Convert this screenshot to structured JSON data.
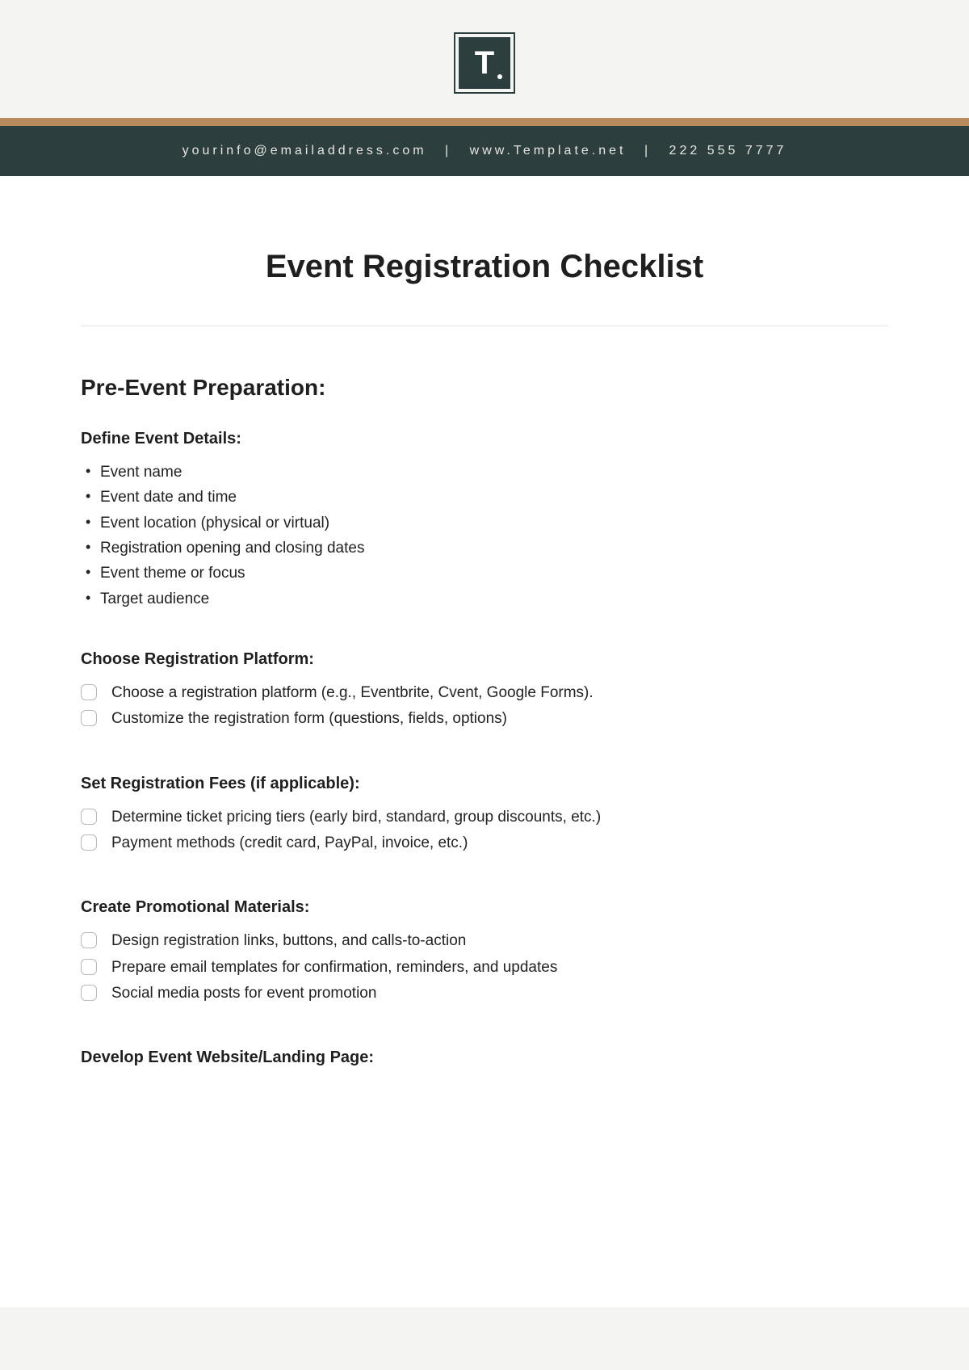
{
  "logo": {
    "letter": "T"
  },
  "contact": {
    "email": "yourinfo@emailaddress.com",
    "website": "www.Template.net",
    "phone": "222 555 7777",
    "sep": "|"
  },
  "title": "Event Registration Checklist",
  "section": {
    "heading": "Pre-Event Preparation:",
    "sub1": {
      "title": "Define Event Details:",
      "items": [
        "Event name",
        "Event date and time",
        "Event location (physical or virtual)",
        "Registration opening and closing dates",
        "Event theme or focus",
        "Target audience"
      ]
    },
    "sub2": {
      "title": "Choose Registration Platform:",
      "items": [
        "Choose a registration platform (e.g., Eventbrite, Cvent, Google Forms).",
        "Customize the registration form (questions, fields, options)"
      ]
    },
    "sub3": {
      "title": "Set Registration Fees (if applicable):",
      "items": [
        "Determine ticket pricing tiers (early bird, standard, group discounts, etc.)",
        "Payment methods (credit card, PayPal, invoice, etc.)"
      ]
    },
    "sub4": {
      "title": "Create Promotional Materials:",
      "items": [
        "Design registration links, buttons, and calls-to-action",
        "Prepare email templates for confirmation, reminders, and updates",
        "Social media posts for event promotion"
      ]
    },
    "sub5": {
      "title": "Develop Event Website/Landing Page:"
    }
  }
}
